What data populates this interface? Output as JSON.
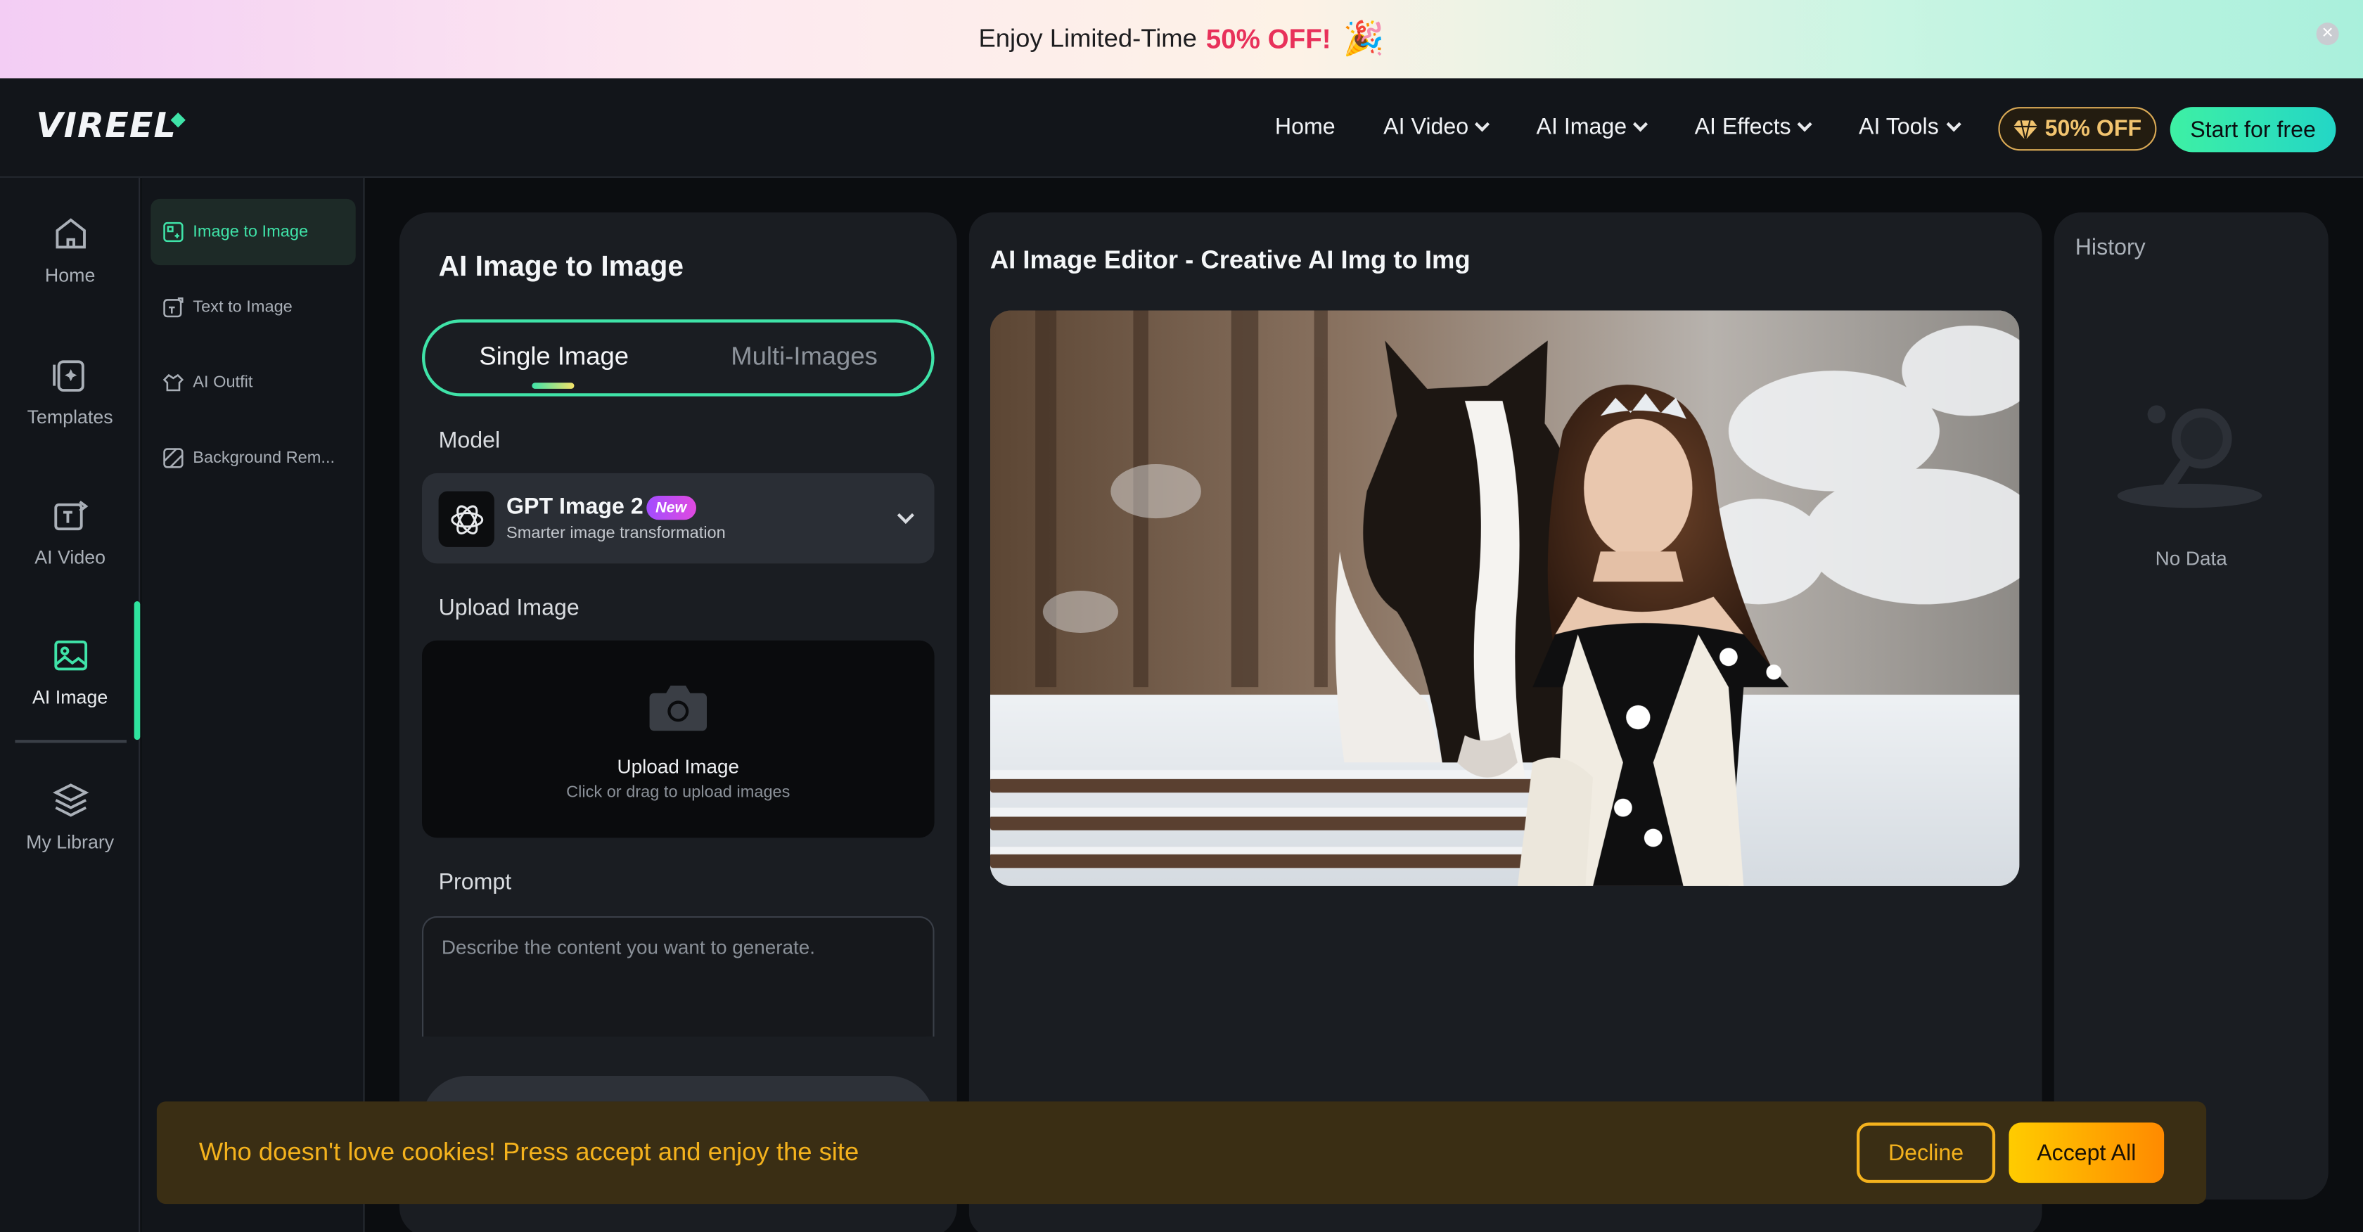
{
  "promo": {
    "text": "Enjoy Limited-Time",
    "highlight": "50% OFF!",
    "emoji": "🎉"
  },
  "header": {
    "logo": "VIREEL",
    "nav": [
      {
        "label": "Home",
        "has_dropdown": false
      },
      {
        "label": "AI Video",
        "has_dropdown": true
      },
      {
        "label": "AI Image",
        "has_dropdown": true
      },
      {
        "label": "AI Effects",
        "has_dropdown": true
      },
      {
        "label": "AI Tools",
        "has_dropdown": true
      }
    ],
    "discount_label": "50% OFF",
    "cta_label": "Start for free"
  },
  "rail": {
    "items": [
      {
        "label": "Home",
        "icon": "home-icon"
      },
      {
        "label": "Templates",
        "icon": "templates-icon"
      },
      {
        "label": "AI Video",
        "icon": "ai-video-icon"
      },
      {
        "label": "AI Image",
        "icon": "ai-image-icon",
        "active": true
      },
      {
        "label": "My Library",
        "icon": "library-icon"
      }
    ]
  },
  "subnav": {
    "items": [
      {
        "label": "Image to Image",
        "active": true
      },
      {
        "label": "Text to Image"
      },
      {
        "label": "AI Outfit"
      },
      {
        "label": "Background Rem..."
      }
    ]
  },
  "panel": {
    "title": "AI Image to Image",
    "tabs": [
      "Single Image",
      "Multi-Images"
    ],
    "model_label": "Model",
    "model": {
      "name": "GPT Image 2",
      "badge": "New",
      "description": "Smarter image transformation"
    },
    "upload_label": "Upload Image",
    "upload": {
      "title": "Upload Image",
      "hint": "Click or drag to upload images"
    },
    "prompt_label": "Prompt",
    "prompt_placeholder": "Describe the content you want to generate."
  },
  "editor": {
    "title": "AI Image Editor - Creative AI Img to Img"
  },
  "history": {
    "title": "History",
    "empty": "No Data"
  },
  "cookie": {
    "text": "Who doesn't love cookies! Press accept and enjoy the site",
    "decline": "Decline",
    "accept": "Accept All"
  },
  "colors": {
    "accent": "#3fe3a8",
    "promo_highlight": "#e8315a",
    "cookie_text": "#f4b21d"
  }
}
